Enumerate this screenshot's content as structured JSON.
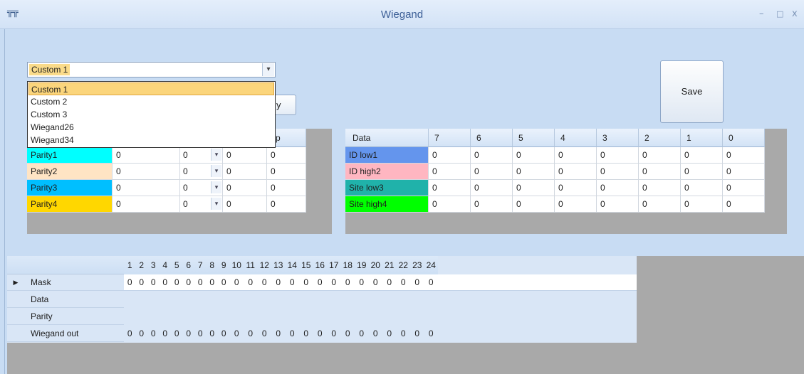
{
  "window": {
    "title": "Wiegand",
    "app_icon": "app-grid-icon",
    "minimize": "–",
    "maximize": "□",
    "close": "x"
  },
  "format_combo": {
    "selected": "Custom 1",
    "options": [
      "Custom 1",
      "Custom 2",
      "Custom 3",
      "Wiegand26",
      "Wiegand34"
    ],
    "highlighted_index": 0
  },
  "buttons": {
    "partial_label": "y",
    "save_label": "Save"
  },
  "parity_grid": {
    "visible_header": "top",
    "rows": [
      {
        "name": "Parity1",
        "color": "#00ffff",
        "v1": "0",
        "v2": "0",
        "v3": "0",
        "v4": "0"
      },
      {
        "name": "Parity2",
        "color": "#ffe4c4",
        "v1": "0",
        "v2": "0",
        "v3": "0",
        "v4": "0"
      },
      {
        "name": "Parity3",
        "color": "#00bfff",
        "v1": "0",
        "v2": "0",
        "v3": "0",
        "v4": "0"
      },
      {
        "name": "Parity4",
        "color": "#ffd700",
        "v1": "0",
        "v2": "0",
        "v3": "0",
        "v4": "0"
      }
    ]
  },
  "data_grid": {
    "headers": [
      "Data",
      "7",
      "6",
      "5",
      "4",
      "3",
      "2",
      "1",
      "0"
    ],
    "rows": [
      {
        "name": "ID low1",
        "color": "#6495ed",
        "values": [
          "0",
          "0",
          "0",
          "0",
          "0",
          "0",
          "0",
          "0"
        ]
      },
      {
        "name": "ID high2",
        "color": "#ffb6c1",
        "values": [
          "0",
          "0",
          "0",
          "0",
          "0",
          "0",
          "0",
          "0"
        ]
      },
      {
        "name": "Site low3",
        "color": "#20b2aa",
        "values": [
          "0",
          "0",
          "0",
          "0",
          "0",
          "0",
          "0",
          "0"
        ]
      },
      {
        "name": "Site high4",
        "color": "#00ff00",
        "values": [
          "0",
          "0",
          "0",
          "0",
          "0",
          "0",
          "0",
          "0"
        ]
      }
    ]
  },
  "bit_grid": {
    "columns": [
      "1",
      "2",
      "3",
      "4",
      "5",
      "6",
      "7",
      "8",
      "9",
      "10",
      "11",
      "12",
      "13",
      "14",
      "15",
      "16",
      "17",
      "18",
      "19",
      "20",
      "21",
      "22",
      "23",
      "24"
    ],
    "rows": [
      {
        "name": "Mask",
        "current": true,
        "marker": "▶",
        "values": [
          "0",
          "0",
          "0",
          "0",
          "0",
          "0",
          "0",
          "0",
          "0",
          "0",
          "0",
          "0",
          "0",
          "0",
          "0",
          "0",
          "0",
          "0",
          "0",
          "0",
          "0",
          "0",
          "0",
          "0"
        ]
      },
      {
        "name": "Data",
        "current": false,
        "values": []
      },
      {
        "name": "Parity",
        "current": false,
        "values": []
      },
      {
        "name": "Wiegand out",
        "current": false,
        "values": [
          "0",
          "0",
          "0",
          "0",
          "0",
          "0",
          "0",
          "0",
          "0",
          "0",
          "0",
          "0",
          "0",
          "0",
          "0",
          "0",
          "0",
          "0",
          "0",
          "0",
          "0",
          "0",
          "0",
          "0"
        ]
      }
    ]
  }
}
